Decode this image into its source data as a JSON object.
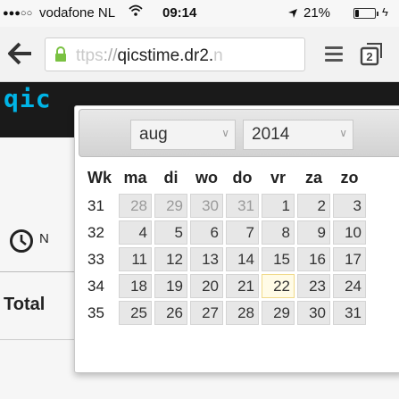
{
  "status_bar": {
    "signal": "●●●○○",
    "carrier": "vodafone NL",
    "wifi_icon": "wifi-icon",
    "time": "09:14",
    "location_icon": "location-arrow-icon",
    "battery": "21%",
    "battery_level": 0.21
  },
  "browser": {
    "url_faded": "ttps",
    "url_light": "://",
    "url_main": "qicstime.dr2.",
    "url_tail": "n",
    "tab_count": "2"
  },
  "page": {
    "logo": "qic",
    "clock_text": "N",
    "total_label": "Total"
  },
  "datepicker": {
    "month": "aug",
    "year": "2014",
    "headers": [
      "Wk",
      "ma",
      "di",
      "wo",
      "do",
      "vr",
      "za",
      "zo"
    ],
    "weeks": [
      {
        "wk": "31",
        "days": [
          "28",
          "29",
          "30",
          "31",
          "1",
          "2",
          "3"
        ],
        "other": [
          true,
          true,
          true,
          true,
          false,
          false,
          false
        ]
      },
      {
        "wk": "32",
        "days": [
          "4",
          "5",
          "6",
          "7",
          "8",
          "9",
          "10"
        ],
        "other": [
          false,
          false,
          false,
          false,
          false,
          false,
          false
        ]
      },
      {
        "wk": "33",
        "days": [
          "11",
          "12",
          "13",
          "14",
          "15",
          "16",
          "17"
        ],
        "other": [
          false,
          false,
          false,
          false,
          false,
          false,
          false
        ]
      },
      {
        "wk": "34",
        "days": [
          "18",
          "19",
          "20",
          "21",
          "22",
          "23",
          "24"
        ],
        "other": [
          false,
          false,
          false,
          false,
          false,
          false,
          false
        ]
      },
      {
        "wk": "35",
        "days": [
          "25",
          "26",
          "27",
          "28",
          "29",
          "30",
          "31"
        ],
        "other": [
          false,
          false,
          false,
          false,
          false,
          false,
          false
        ]
      }
    ],
    "today": "22"
  },
  "colors": {
    "logo": "#00b4e6",
    "header_dark": "#1a1a1a",
    "today_bg": "#fffbe6"
  }
}
